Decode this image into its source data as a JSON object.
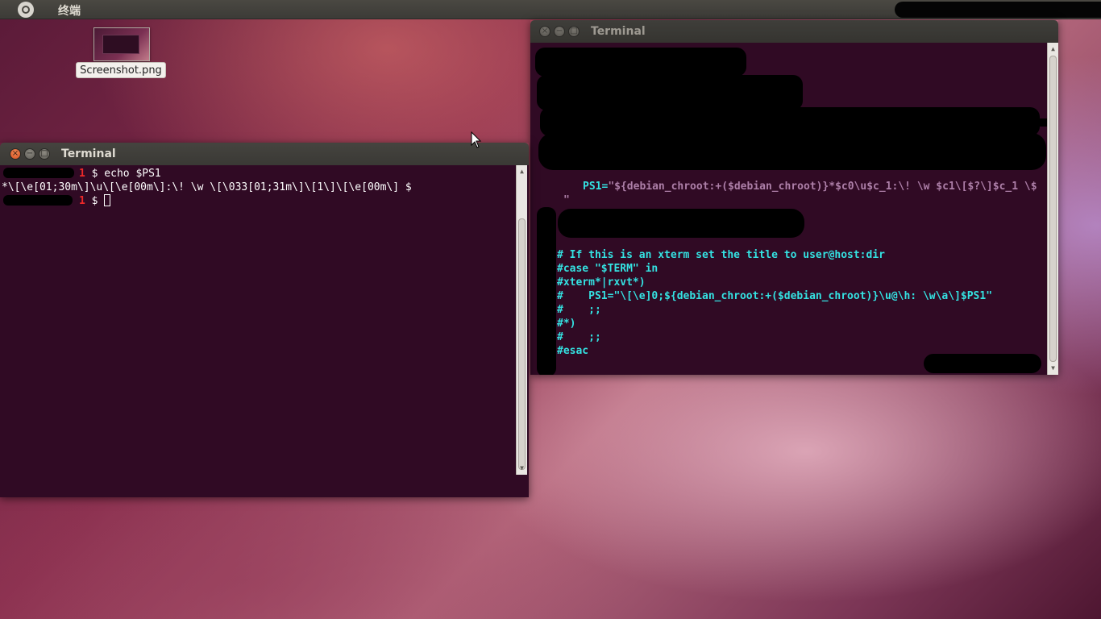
{
  "panel": {
    "title": "终端"
  },
  "desktop": {
    "icon_label": "Screenshot.png"
  },
  "window_left": {
    "title": "Terminal",
    "lines": {
      "l1_num": "1",
      "l1_cmd": " $ echo $PS1",
      "l2": "*\\[\\e[01;30m\\]\\u\\[\\e[00m\\]:\\! \\w \\[\\033[01;31m\\]\\[1\\]\\[\\e[00m\\] $",
      "l3_num": "1",
      "l3_prompt": " $ "
    }
  },
  "window_right": {
    "title": "Terminal",
    "lines": {
      "ps1_key": "PS1=",
      "ps1_value": "\"${debian_chroot:+($debian_chroot)}*$c0\\u$c_1:\\! \\w $c1\\[$?\\]$c_1 \\$",
      "ps1_cont": "\"",
      "c1": "# If this is an xterm set the title to user@host:dir",
      "c2": "#case \"$TERM\" in",
      "c3": "#xterm*|rxvt*)",
      "c4": "#    PS1=\"\\[\\e]0;${debian_chroot:+($debian_chroot)}\\u@\\h: \\w\\a\\]$PS1\"",
      "c5": "#    ;;",
      "c6": "#*)",
      "c7": "#    ;;",
      "c8": "#esac"
    }
  },
  "colors": {
    "terminal_bg": "#300a24",
    "prompt_red": "#ef2929",
    "comment_cyan": "#34e2e2",
    "string_violet": "#ad7fa8"
  }
}
